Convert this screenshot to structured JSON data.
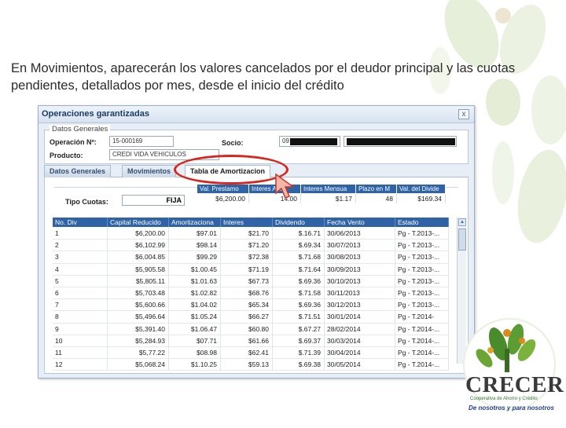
{
  "caption": "En Movimientos, aparecerán los valores cancelados por el deudor principal y las cuotas pendientes, detallados por mes, desde el inicio del crédito",
  "window": {
    "title": "Operaciones garantizadas",
    "close_label": "x",
    "general": {
      "legend": "Datos Generales",
      "operacion_label": "Operación Nº:",
      "operacion_value": "15-000169",
      "producto_label": "Producto:",
      "producto_value": "CREDI VIDA VEHICULOS",
      "socio_label": "Socio:",
      "socio_value": "09"
    },
    "tabs": [
      "Datos Generales",
      "Movimientos",
      "Tabla de Amortizacion"
    ],
    "active_tab": "Tabla de Amortizacion",
    "summary": {
      "tipo_cuotas_label": "Tipo Cuotas:",
      "tipo_cuotas_value": "FIJA",
      "headers": [
        "Val. Prestamo",
        "Interes Anu",
        "Interes Mensua",
        "Plazo en M",
        "Val. del Divide"
      ],
      "values": [
        "$6,200.00",
        "14.00",
        "$1.17",
        "48",
        "$169.34"
      ]
    },
    "table": {
      "headers": [
        "No. Div",
        "Capital Reducido",
        "Amortizaciona",
        "Interes",
        "Dividendo",
        "Fecha Vento",
        "Estado"
      ],
      "rows": [
        [
          "1",
          "$6,200.00",
          "$97.01",
          "$21.70",
          "$.16.71",
          "30/06/2013",
          "Pg - T.2013-..."
        ],
        [
          "2",
          "$6,102.99",
          "$98.14",
          "$71.20",
          "$.69.34",
          "30/07/2013",
          "Pg - T.2013-..."
        ],
        [
          "3",
          "$6,004.85",
          "$99.29",
          "$72.38",
          "$.71.68",
          "30/08/2013",
          "Pg - T.2013-..."
        ],
        [
          "4",
          "$5,905.58",
          "$1.00.45",
          "$71.19",
          "$.71.64",
          "30/09/2013",
          "Pg - T.2013-..."
        ],
        [
          "5",
          "$5,805.11",
          "$1.01.63",
          "$67.73",
          "$.69.36",
          "30/10/2013",
          "Pg - T.2013-..."
        ],
        [
          "6",
          "$5,703.48",
          "$1.02.82",
          "$68.76",
          "$.71.58",
          "30/11/2013",
          "Pg - T.2013-..."
        ],
        [
          "7",
          "$5,600.66",
          "$1.04.02",
          "$65.34",
          "$.69.36",
          "30/12/2013",
          "Pg - T.2013-..."
        ],
        [
          "8",
          "$5,496.64",
          "$1.05.24",
          "$66.27",
          "$.71.51",
          "30/01/2014",
          "Pg - T.2014-"
        ],
        [
          "9",
          "$5,391.40",
          "$1.06.47",
          "$60.80",
          "$.67.27",
          "28/02/2014",
          "Pg - T.2014-..."
        ],
        [
          "10",
          "$5,284.93",
          "$07.71",
          "$61.66",
          "$.69.37",
          "30/03/2014",
          "Pg - T.2014-..."
        ],
        [
          "11",
          "$5,77.22",
          "$08.98",
          "$62.41",
          "$.71.39",
          "30/04/2014",
          "Pg - T.2014-..."
        ],
        [
          "12",
          "$5,068.24",
          "$1.10.25",
          "$59.13",
          "$.69.38",
          "30/05/2014",
          "Pg - T.2014-..."
        ]
      ]
    }
  },
  "logo": {
    "word": "CRECER",
    "sub": "Cooperativa de Ahorro y Crédito",
    "tagline": "De nosotros y para nosotros"
  },
  "colors": {
    "grid_header": "#2e63a8",
    "annotation": "#d9261c",
    "logo_green": "#2f7a2c"
  }
}
